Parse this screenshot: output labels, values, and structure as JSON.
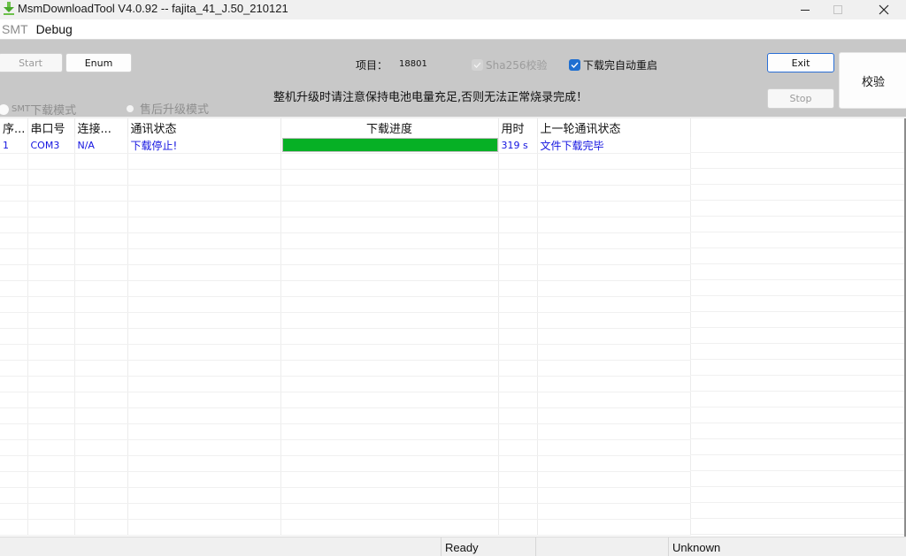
{
  "window": {
    "title": "MsmDownloadTool V4.0.92 -- fajita_41_J.50_210121",
    "icon": "download-arrow-icon",
    "controls": {
      "minimize": "minimize-icon",
      "maximize": "maximize-icon",
      "close": "close-icon"
    }
  },
  "menubar": {
    "items": [
      {
        "label": "SMT",
        "enabled": false
      },
      {
        "label": "Debug",
        "enabled": true
      }
    ]
  },
  "toolbar": {
    "start_label": "Start",
    "enum_label": "Enum",
    "exit_label": "Exit",
    "stop_label": "Stop",
    "verify_label": "校验",
    "project_label": "项目：",
    "project_value": "18801",
    "sha256_label": "Sha256校验",
    "sha256_checked": true,
    "sha256_enabled": false,
    "auto_reboot_label": "下载完自动重启",
    "auto_reboot_checked": true,
    "warning": "整机升级时请注意保持电池电量充足,否则无法正常烧录完成！",
    "mode_smt_prefix": "SMT",
    "mode_smt_label": "下载模式",
    "mode_aftersale_label": "售后升级模式"
  },
  "table": {
    "columns": [
      "序...",
      "串口号",
      "连接...",
      "通讯状态",
      "下载进度",
      "用时",
      "上一轮通讯状态"
    ],
    "rows": [
      {
        "index": "1",
        "port": "COM3",
        "connection": "N/A",
        "status": "下载停止!",
        "progress_percent": 100,
        "elapsed": "319 s",
        "last_status": "文件下载完毕"
      }
    ],
    "empty_rows": 24
  },
  "colors": {
    "progress": "#06b025",
    "row_text": "#1414e0",
    "checkbox_accent": "#1f6fd1",
    "panel_bg": "#c8c8c8"
  },
  "statusbar": {
    "ready": "Ready",
    "middle": "",
    "state": "Unknown"
  }
}
